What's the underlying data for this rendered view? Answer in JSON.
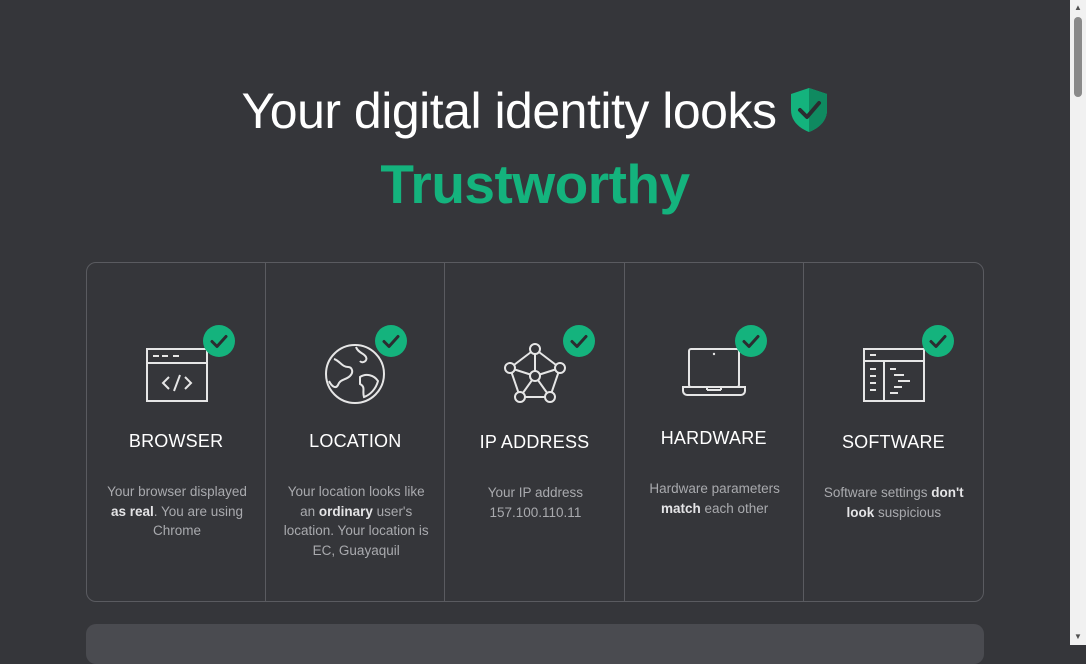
{
  "header": {
    "headline": "Your digital identity looks",
    "verdict": "Trustworthy"
  },
  "colors": {
    "accent": "#14b37d",
    "background": "#35363a"
  },
  "cards": [
    {
      "icon": "browser-code-icon",
      "title": "BROWSER",
      "desc": {
        "pre": "Your browser displayed ",
        "bold": "as real",
        "post": ". You are using Chrome"
      }
    },
    {
      "icon": "globe-icon",
      "title": "LOCATION",
      "desc": {
        "pre": "Your location looks like an ",
        "bold": "ordinary",
        "post": " user's location. Your location is EC, Guayaquil"
      }
    },
    {
      "icon": "network-icon",
      "title": "IP ADDRESS",
      "desc": {
        "pre": "Your IP address 157.100.110.11",
        "bold": "",
        "post": ""
      }
    },
    {
      "icon": "laptop-icon",
      "title": "HARDWARE",
      "desc": {
        "pre": "Hardware parameters ",
        "bold": "match",
        "post": " each other"
      }
    },
    {
      "icon": "software-window-icon",
      "title": "SOFTWARE",
      "desc": {
        "pre": "Software settings ",
        "bold": "don't look",
        "post": " suspicious"
      }
    }
  ]
}
